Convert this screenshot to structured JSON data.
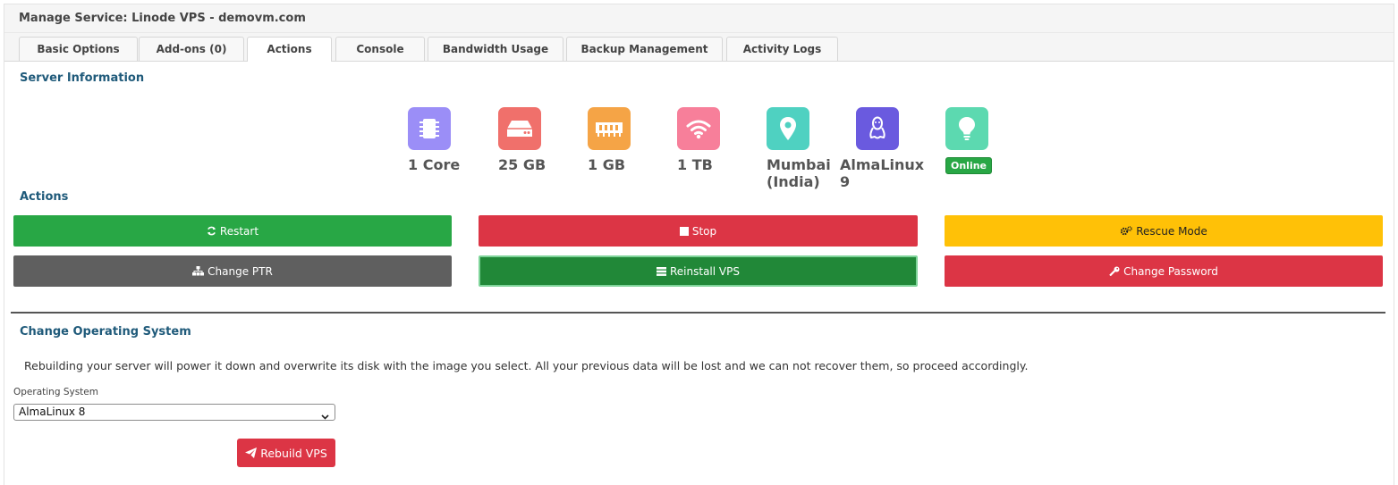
{
  "header": {
    "title": "Manage Service: Linode VPS - demovm.com"
  },
  "tabs": [
    {
      "label": "Basic Options"
    },
    {
      "label": "Add-ons (0)"
    },
    {
      "label": "Actions"
    },
    {
      "label": "Console"
    },
    {
      "label": "Bandwidth Usage"
    },
    {
      "label": "Backup Management"
    },
    {
      "label": "Activity Logs"
    }
  ],
  "server_info": {
    "title": "Server Information",
    "specs": [
      {
        "icon": "cpu-icon",
        "value": "1 Core",
        "color": "#9b8ef7"
      },
      {
        "icon": "hard-drive-icon",
        "value": "25 GB",
        "color": "#f0706b"
      },
      {
        "icon": "memory-icon",
        "value": "1 GB",
        "color": "#f5a446"
      },
      {
        "icon": "wifi-icon",
        "value": "1 TB",
        "color": "#f77f9a"
      },
      {
        "icon": "map-pin-icon",
        "value": "Mumbai (India)",
        "color": "#4fd1c1"
      },
      {
        "icon": "linux-icon",
        "value": "AlmaLinux 9",
        "color": "#6a5adf"
      },
      {
        "icon": "lightbulb-icon",
        "value": "Online",
        "color": "#5cd9b0"
      }
    ]
  },
  "actions": {
    "title": "Actions",
    "restart": "Restart",
    "stop": "Stop",
    "rescue": "Rescue Mode",
    "change_ptr": "Change PTR",
    "reinstall": "Reinstall VPS",
    "change_password": "Change Password"
  },
  "os": {
    "title": "Change Operating System",
    "note": "Rebuilding your server will power it down and overwrite its disk with the image you select. All your previous data will be lost and we can not recover them, so proceed accordingly.",
    "field_label": "Operating System",
    "selected": "AlmaLinux 8",
    "rebuild": "Rebuild VPS"
  },
  "colors": {
    "green": "#28a745",
    "red": "#dc3545",
    "yellow": "#ffc107",
    "gray": "#5f5f5f",
    "dark_green": "#218838",
    "title_blue": "#1f5a7a"
  }
}
